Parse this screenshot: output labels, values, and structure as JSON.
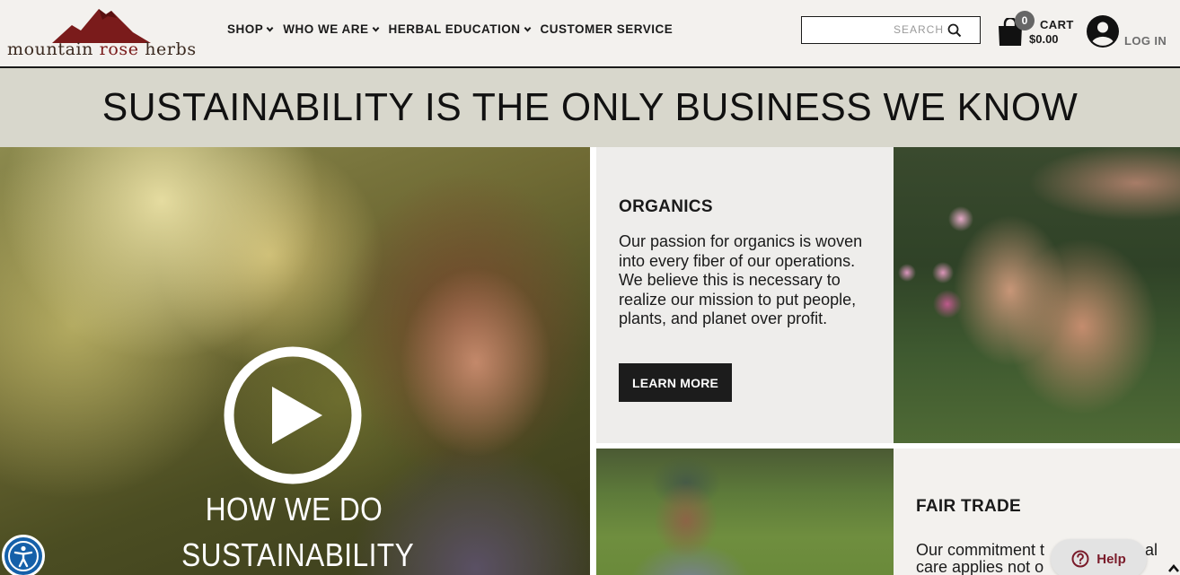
{
  "header": {
    "logo": {
      "text_left": "mountain ",
      "text_rose": "rose",
      "text_right": " herbs",
      "icon": "mountain-logo-icon"
    },
    "nav": [
      {
        "label": "SHOP",
        "has_dropdown": true
      },
      {
        "label": "WHO WE ARE",
        "has_dropdown": true
      },
      {
        "label": "HERBAL EDUCATION",
        "has_dropdown": true
      },
      {
        "label": "CUSTOMER SERVICE",
        "has_dropdown": false
      }
    ],
    "search": {
      "placeholder": "SEARCH",
      "value": "",
      "icon": "search-icon"
    },
    "cart": {
      "count": "0",
      "label": "CART",
      "total": "$0.00",
      "icon": "shopping-bag-icon"
    },
    "login": {
      "label": "LOG IN",
      "icon": "user-icon"
    }
  },
  "banner": {
    "title": "SUSTAINABILITY IS THE ONLY BUSINESS WE KNOW"
  },
  "video": {
    "caption_line1": "HOW WE DO",
    "caption_line2": "SUSTAINABILITY",
    "icon": "play-icon"
  },
  "organics": {
    "title": "ORGANICS",
    "body": "Our passion for organics is woven into every fiber of our operations. We believe this is necessary to realize our mission to put people, plants, and planet over profit.",
    "button_label": "LEARN MORE"
  },
  "fair_trade": {
    "title": "FAIR TRADE",
    "body_line1": "Our commitment t",
    "body_line1_end": "al",
    "body_line2": "care applies not o"
  },
  "widgets": {
    "help_label": "Help",
    "accessibility_icon": "accessibility-icon",
    "help_icon": "question-icon",
    "scroll_icon": "chevron-up-icon"
  },
  "colors": {
    "header_bg": "#f3f1ee",
    "banner_bg": "#d8d7cc",
    "button_bg": "#1c1c1c",
    "logo_rose": "#7a1b1b",
    "help_text": "#7a1b2a",
    "accessibility_blue": "#1560a9"
  }
}
